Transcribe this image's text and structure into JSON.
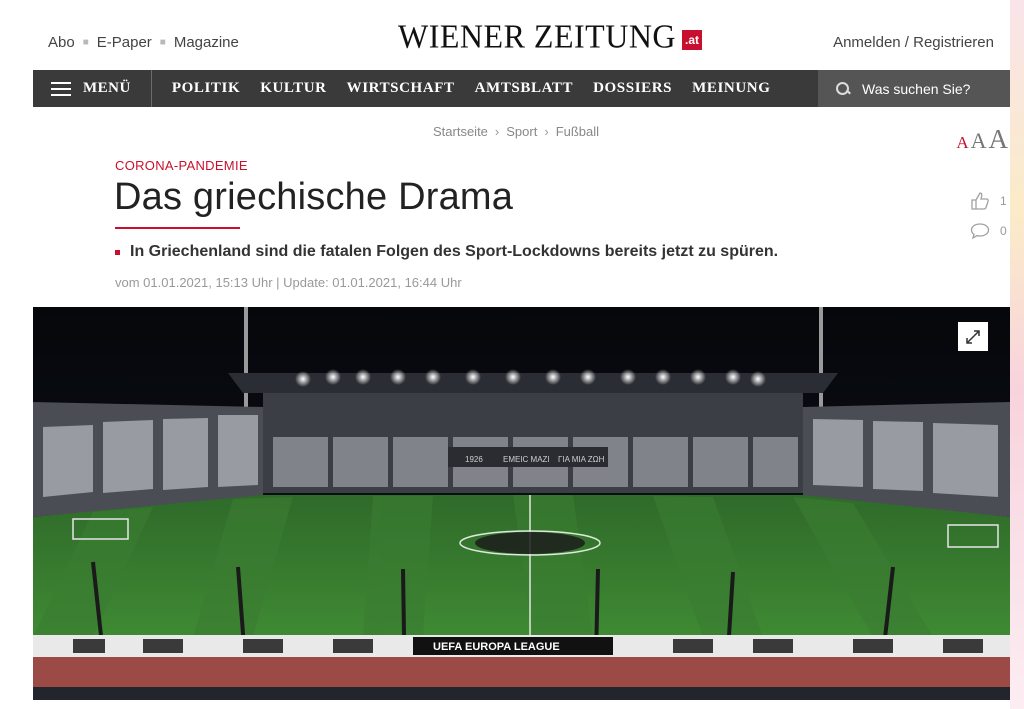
{
  "header": {
    "top_links": [
      "Abo",
      "E-Paper",
      "Magazine"
    ],
    "logo_text": "WIENER ZEITUNG",
    "logo_badge": ".at",
    "auth_label": "Anmelden / Registrieren"
  },
  "nav": {
    "menu_label": "MENÜ",
    "items": [
      "POLITIK",
      "KULTUR",
      "WIRTSCHAFT",
      "AMTSBLATT",
      "DOSSIERS",
      "MEINUNG"
    ],
    "search_placeholder": "Was suchen Sie?"
  },
  "breadcrumb": [
    "Startseite",
    "Sport",
    "Fußball"
  ],
  "font_controls": [
    "A",
    "A",
    "A"
  ],
  "article": {
    "kicker": "CORONA-PANDEMIE",
    "headline": "Das griechische Drama",
    "lead": "In Griechenland sind die fatalen Folgen des Sport-Lockdowns bereits jetzt zu spüren.",
    "meta": "vom 01.01.2021, 15:13 Uhr | Update: 01.01.2021, 16:44 Uhr"
  },
  "social": {
    "likes": "1",
    "comments": "0"
  },
  "hero": {
    "stadium_texts": [
      "1926",
      "EMEIC MAZI",
      "ΓΙΑ ΜΙΑ ΖΩΗ"
    ],
    "board_text": "UEFA EUROPA LEAGUE"
  },
  "colors": {
    "accent": "#c8102e",
    "navbar": "#3a3a3a",
    "search_bg": "#555555"
  }
}
